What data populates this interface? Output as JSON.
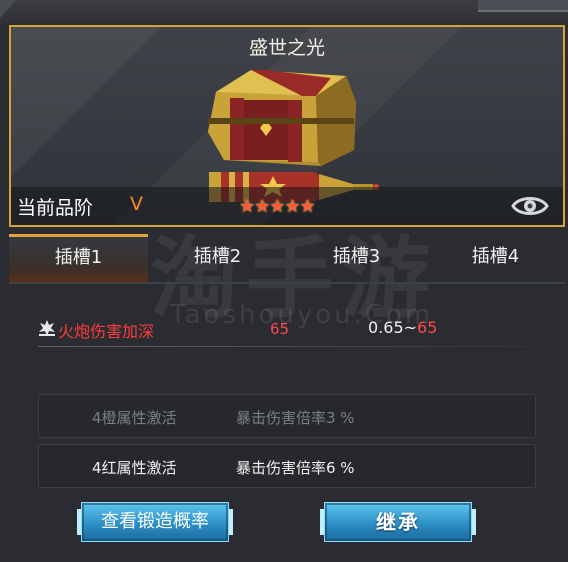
{
  "item": {
    "title": "盛世之光",
    "quality_label": "当前品阶",
    "quality_grade": "V",
    "stars": "★★★★★"
  },
  "tabs": [
    {
      "label": "插槽1",
      "active": true
    },
    {
      "label": "插槽2",
      "active": false
    },
    {
      "label": "插槽3",
      "active": false
    },
    {
      "label": "插槽4",
      "active": false
    }
  ],
  "watermark": {
    "main": "淘手游",
    "sub": "Taoshouyou.Com"
  },
  "attribute": {
    "name": "火炮伤害加深",
    "value": "65",
    "range_low": "0.65~",
    "range_high": "65"
  },
  "set_bonuses": [
    {
      "name": "4橙属性激活",
      "desc": "暴击伤害倍率3 %",
      "active": false
    },
    {
      "name": "4红属性激活",
      "desc": "暴击伤害倍率6 %",
      "active": true
    }
  ],
  "buttons": {
    "forge_rate": "查看锻造概率",
    "inherit": "继承"
  },
  "colors": {
    "frame_gold": "#d6a23c",
    "grade_orange": "#ff8a1c",
    "attr_red": "#ff3b3b",
    "button_blue": "#2c8fc6"
  },
  "icons": {
    "eye": "eye-icon",
    "attr": "explosion-icon"
  }
}
